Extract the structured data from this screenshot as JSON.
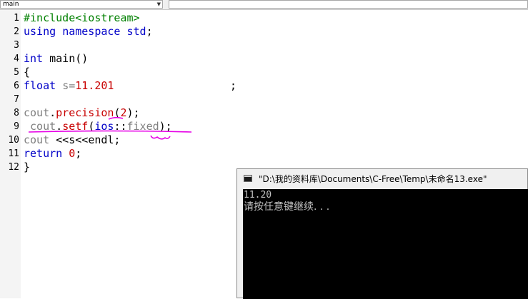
{
  "toolbar": {
    "function_combo_value": "main"
  },
  "editor": {
    "lines": [
      {
        "num": "1",
        "parts": [
          "#include<iostream>"
        ]
      },
      {
        "num": "2",
        "parts": [
          "using",
          " ",
          "namespace",
          " ",
          "std",
          ";"
        ]
      },
      {
        "num": "3",
        "parts": []
      },
      {
        "num": "4",
        "parts": [
          "int",
          " ",
          "main",
          "()"
        ]
      },
      {
        "num": "5",
        "parts": [
          "{"
        ]
      },
      {
        "num": "6",
        "parts": [
          "float",
          " ",
          "s=",
          "11.201",
          "                  ;"
        ]
      },
      {
        "num": "7",
        "parts": []
      },
      {
        "num": "8",
        "parts": [
          "cout",
          ".",
          "precision",
          "(",
          "2",
          ");"
        ]
      },
      {
        "num": "9",
        "parts": [
          " cout",
          ".",
          "setf",
          "(",
          "ios",
          "::",
          "fixed",
          ");"
        ]
      },
      {
        "num": "10",
        "parts": [
          "cout ",
          "<<",
          "s",
          "<<",
          "endl;"
        ]
      },
      {
        "num": "11",
        "parts": [
          "return",
          " ",
          "0",
          ";"
        ]
      },
      {
        "num": "12",
        "parts": [
          "}"
        ]
      }
    ]
  },
  "console_window": {
    "title": "\"D:\\我的资料库\\Documents\\C-Free\\Temp\\未命名13.exe\"",
    "output_line1": "11.20",
    "output_line2": "请按任意键继续. . ."
  },
  "colors": {
    "keyword": "#0000c8",
    "preprocessor": "#008000",
    "number": "#c80000",
    "identifier": "#808080",
    "annotation": "#e600e6",
    "console_bg": "#000000",
    "console_text": "#c0c0c0"
  }
}
